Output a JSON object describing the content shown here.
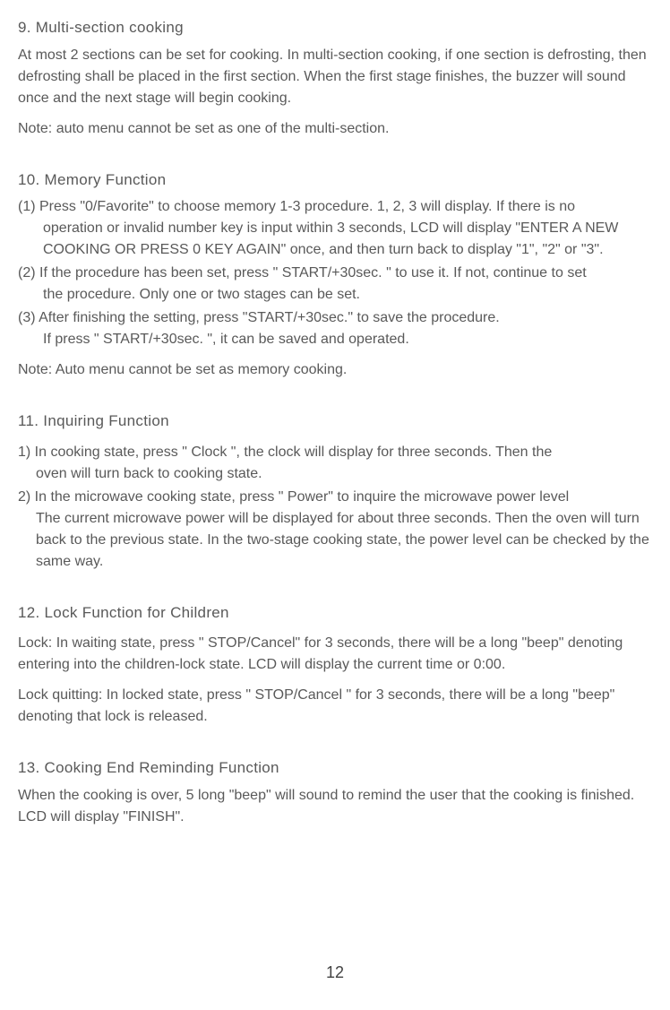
{
  "section9": {
    "heading": "9. Multi-section cooking",
    "p1": "At most 2 sections can be set for cooking. In multi-section cooking, if one section is defrosting, then defrosting shall be placed in the first section. When the first stage finishes, the buzzer will sound once and the next stage will begin cooking.",
    "note": "Note: auto menu cannot be set as one of the multi-section."
  },
  "section10": {
    "heading": "10. Memory Function",
    "item1_prefix": "(1) ",
    "item1_line1": "Press \"0/Favorite\" to choose memory 1-3 procedure. 1, 2, 3 will display. If there is no",
    "item1_line2": "operation or invalid number key is input within 3 seconds, LCD will display \"ENTER A NEW COOKING OR PRESS 0 KEY AGAIN\" once, and then turn back to display \"1\", \"2\" or \"3\".",
    "item2_prefix": "(2) ",
    "item2_line1": "If the procedure has been set, press \" START/+30sec. \" to use it. If not, continue to set",
    "item2_line2": "the procedure. Only one or two stages can be set.",
    "item3_prefix": "(3) ",
    "item3_line1": "After finishing the setting, press \"START/+30sec.\" to save the procedure.",
    "item3_line2": "If press \" START/+30sec. \", it can be saved and operated.",
    "note": "Note: Auto menu cannot be set as memory cooking."
  },
  "section11": {
    "heading": "11. Inquiring Function",
    "item1_prefix": "1) ",
    "item1_line1": "In cooking state, press \" Clock \", the clock will display for three seconds. Then the",
    "item1_line2": "oven will turn back to cooking state.",
    "item2_prefix": "2) ",
    "item2_line1": "In the microwave cooking state, press \" Power\" to inquire the microwave power level",
    "item2_line2": "The current microwave power will be displayed for about three seconds. Then the oven will turn back to the previous state. In the two-stage cooking state, the power level can be checked by the same way."
  },
  "section12": {
    "heading": "12. Lock Function for Children",
    "p1": "Lock: In waiting state, press \" STOP/Cancel\" for 3 seconds, there will be a long \"beep\" denoting entering into the children-lock state. LCD will display the current time or 0:00.",
    "p2": "Lock quitting: In locked state, press \" STOP/Cancel \" for 3 seconds, there will be a long \"beep\" denoting that lock is released."
  },
  "section13": {
    "heading": "13. Cooking End Reminding Function",
    "p1": "When the cooking is over, 5 long \"beep\" will sound to remind the user that the cooking is finished. LCD will display \"FINISH\"."
  },
  "page_number": "12"
}
